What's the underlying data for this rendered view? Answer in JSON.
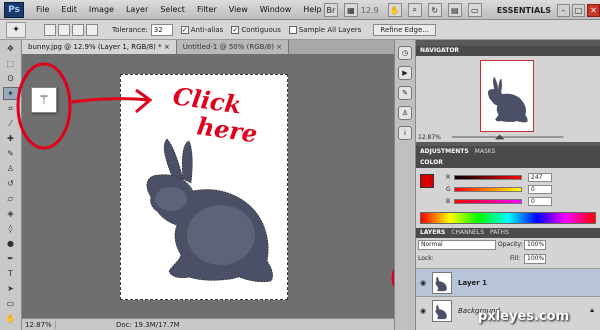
{
  "app": {
    "logo": "Ps"
  },
  "menu": {
    "items": [
      "File",
      "Edit",
      "Image",
      "Layer",
      "Select",
      "Filter",
      "View",
      "Window",
      "Help"
    ],
    "zoom_readout": "12.9",
    "workspace": "ESSENTIALS",
    "window_controls": [
      "–",
      "□",
      "✕"
    ]
  },
  "options": {
    "tolerance_label": "Tolerance:",
    "tolerance_value": "32",
    "anti_alias": "Anti-alias",
    "contiguous": "Contiguous",
    "sample_all": "Sample All Layers",
    "refine_edge": "Refine Edge..."
  },
  "tabs": [
    {
      "label": "bunny.jpg @ 12.9% (Layer 1, RGB/8) *",
      "close": "×"
    },
    {
      "label": "Untitled-1 @ 50% (RGB/8)",
      "close": "×"
    }
  ],
  "annotation": {
    "text_line1": "Click",
    "text_line2": "here",
    "color": "#e0001a"
  },
  "status": {
    "zoom": "12.87%",
    "doc_info": "Doc: 19.3M/17.7M"
  },
  "navigator": {
    "title": "NAVIGATOR",
    "zoom": "12.87%"
  },
  "adjustments": {
    "tabs": [
      "ADJUSTMENTS",
      "MASKS"
    ]
  },
  "color": {
    "title": "COLOR",
    "r_label": "R",
    "r_value": "247",
    "g_label": "G",
    "g_value": "0",
    "b_label": "B",
    "b_value": "0",
    "foreground": "#d50000"
  },
  "layers": {
    "tabs": [
      "LAYERS",
      "CHANNELS",
      "PATHS"
    ],
    "blend_mode": "Normal",
    "opacity_label": "Opacity:",
    "opacity_value": "100%",
    "lock_label": "Lock:",
    "fill_label": "Fill:",
    "fill_value": "100%",
    "rows": [
      {
        "name": "Layer 1",
        "selected": true
      },
      {
        "name": "Background",
        "selected": false
      }
    ]
  },
  "watermark": "pxleyes.com"
}
